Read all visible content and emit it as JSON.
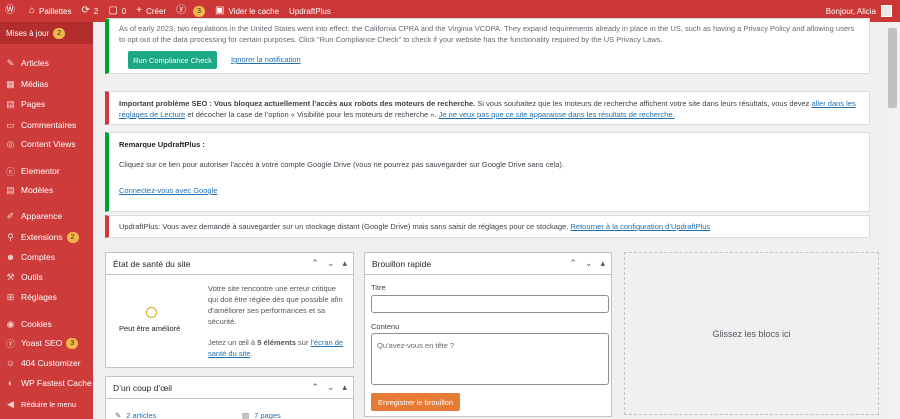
{
  "adminbar": {
    "site_name": "Paillettes",
    "updates_count": "2",
    "comments_count": "0",
    "new_label": "Créer",
    "yoast_count": "3",
    "clear_cache": "Vider le cache",
    "updraft": "UpdraftPlus",
    "greeting": "Bonjour, Alicia"
  },
  "sidebar": {
    "update_label": "Mises à jour",
    "update_count": "2",
    "items": [
      {
        "label": "Articles",
        "icon": "pin-icon"
      },
      {
        "label": "Médias",
        "icon": "media-icon"
      },
      {
        "label": "Pages",
        "icon": "pages-icon"
      },
      {
        "label": "Commentaires",
        "icon": "comments-icon"
      },
      {
        "label": "Content Views",
        "icon": "cv-icon"
      },
      {
        "label": "Elementor",
        "icon": "elementor-icon"
      },
      {
        "label": "Modèles",
        "icon": "templates-icon"
      },
      {
        "label": "Apparence",
        "icon": "brush-icon"
      },
      {
        "label": "Extensions",
        "icon": "plugins-icon",
        "badge": "2"
      },
      {
        "label": "Comptes",
        "icon": "users-icon"
      },
      {
        "label": "Outils",
        "icon": "tools-icon"
      },
      {
        "label": "Réglages",
        "icon": "settings-icon"
      },
      {
        "label": "Cookies",
        "icon": "cookie-icon"
      },
      {
        "label": "Yoast SEO",
        "icon": "yoast-icon",
        "badge": "3"
      },
      {
        "label": "404 Customizer",
        "icon": "customizer-icon"
      },
      {
        "label": "WP Fastest Cache",
        "icon": "cache-icon"
      }
    ],
    "collapse_label": "Réduire le menu"
  },
  "notices": {
    "privacy_text": "As of early 2023, two regulations in the United States went into effect: the California CPRA and the Virginia VCDPA. They expand requirements already in place in the US, such as having a Privacy Policy and allowing users to opt out of the data processing for certain purposes. Click \"Run Compliance Check\" to check if your website has the functionality required by the US Privacy Laws.",
    "run_check": "Run Compliance Check",
    "ignore": "Ignorer la notification",
    "seo_strong": "Important problème SEO : Vous bloquez actuellement l’accès aux robots des moteurs de recherche.",
    "seo_text": " Si vous souhaitez que les moteurs de recherche affichent votre site dans leurs résultats, vous devez ",
    "seo_link1": "aller dans les réglages de Lecture",
    "seo_text2": " et décocher la case de l’option « Visibilité pour les moteurs de recherche ». ",
    "seo_link2": "Je ne veux pas que ce site apparaisse dans les résultats de recherche.",
    "updraft_title": "Remarque UpdraftPlus :",
    "updraft_text": "Cliquez sur ce lien pour autoriser l'accès à votre compte Google Drive (vous ne pourrez pas sauvegarder sur Google Drive sans cela).",
    "updraft_connect": "Connectez-vous avec Google",
    "updraft_warn": "UpdraftPlus: Vous avez demandé à sauvegarder sur un stockage distant (Google Drive) mais sans saisir de réglages pour ce stockage. ",
    "updraft_return": "Retourner à la configuration d’UpdraftPlus"
  },
  "health": {
    "title": "État de santé du site",
    "status": "Peut être amélioré",
    "desc": "Votre site rencontre une erreur critique qui doit être réglée dès que possible afin d’améliorer ses performances et sa sécurité.",
    "desc2_a": "Jetez un œil à ",
    "desc2_bold": "5 éléments",
    "desc2_b": " sur ",
    "desc2_link": "l’écran de santé du site",
    "desc2_end": "."
  },
  "glance": {
    "title": "D’un coup d’œil",
    "articles": "2 articles",
    "pages": "7 pages"
  },
  "draft": {
    "title": "Brouillon rapide",
    "title_label": "Titre",
    "content_label": "Contenu",
    "content_placeholder": "Qu’avez-vous en tête ?",
    "save": "Enregistrer le brouillon"
  },
  "dropzone": "Glissez les blocs ici",
  "colors": {
    "adminbar": "#cb3737",
    "sidebar": "#cd3b3b",
    "accent_green": "#1da884",
    "accent_orange": "#e57b34",
    "link": "#2271b1"
  }
}
